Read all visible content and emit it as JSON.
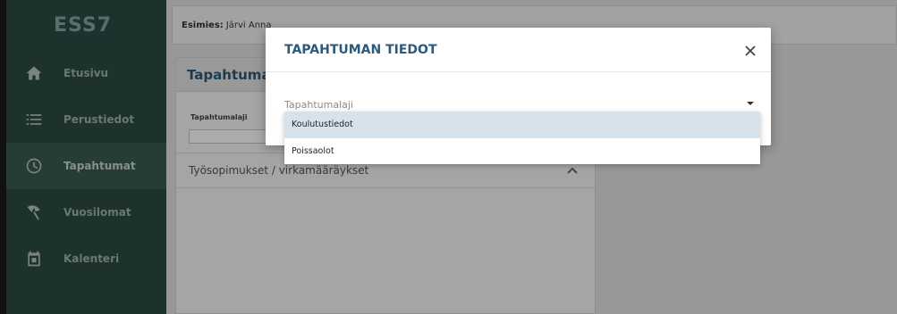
{
  "sidebar": {
    "logo": "ESS7",
    "items": [
      {
        "label": "Etusivu",
        "icon": "home-icon"
      },
      {
        "label": "Perustiedot",
        "icon": "list-icon"
      },
      {
        "label": "Tapahtumat",
        "icon": "clock-icon",
        "active": true
      },
      {
        "label": "Vuosilomat",
        "icon": "beach-umbrella-icon"
      },
      {
        "label": "Kalenteri",
        "icon": "calendar-icon"
      }
    ]
  },
  "topbar": {
    "label": "Esimies:",
    "value": "Järvi Anna"
  },
  "panel": {
    "title": "Tapahtumat",
    "field_label": "Tapahtumalaji",
    "accordion_label": "Työsopimukset / virkamääräykset"
  },
  "modal": {
    "title": "TAPAHTUMAN TIEDOT",
    "close_symbol": "×",
    "select_label": "Tapahtumalaji",
    "options": [
      "Koulutustiedot",
      "Poissaolot"
    ],
    "highlighted_option": "Koulutustiedot"
  },
  "colors": {
    "sidebar_bg": "#2c4a44",
    "accent_title": "#2d5a7a",
    "option_highlight": "#d6e2ec"
  }
}
